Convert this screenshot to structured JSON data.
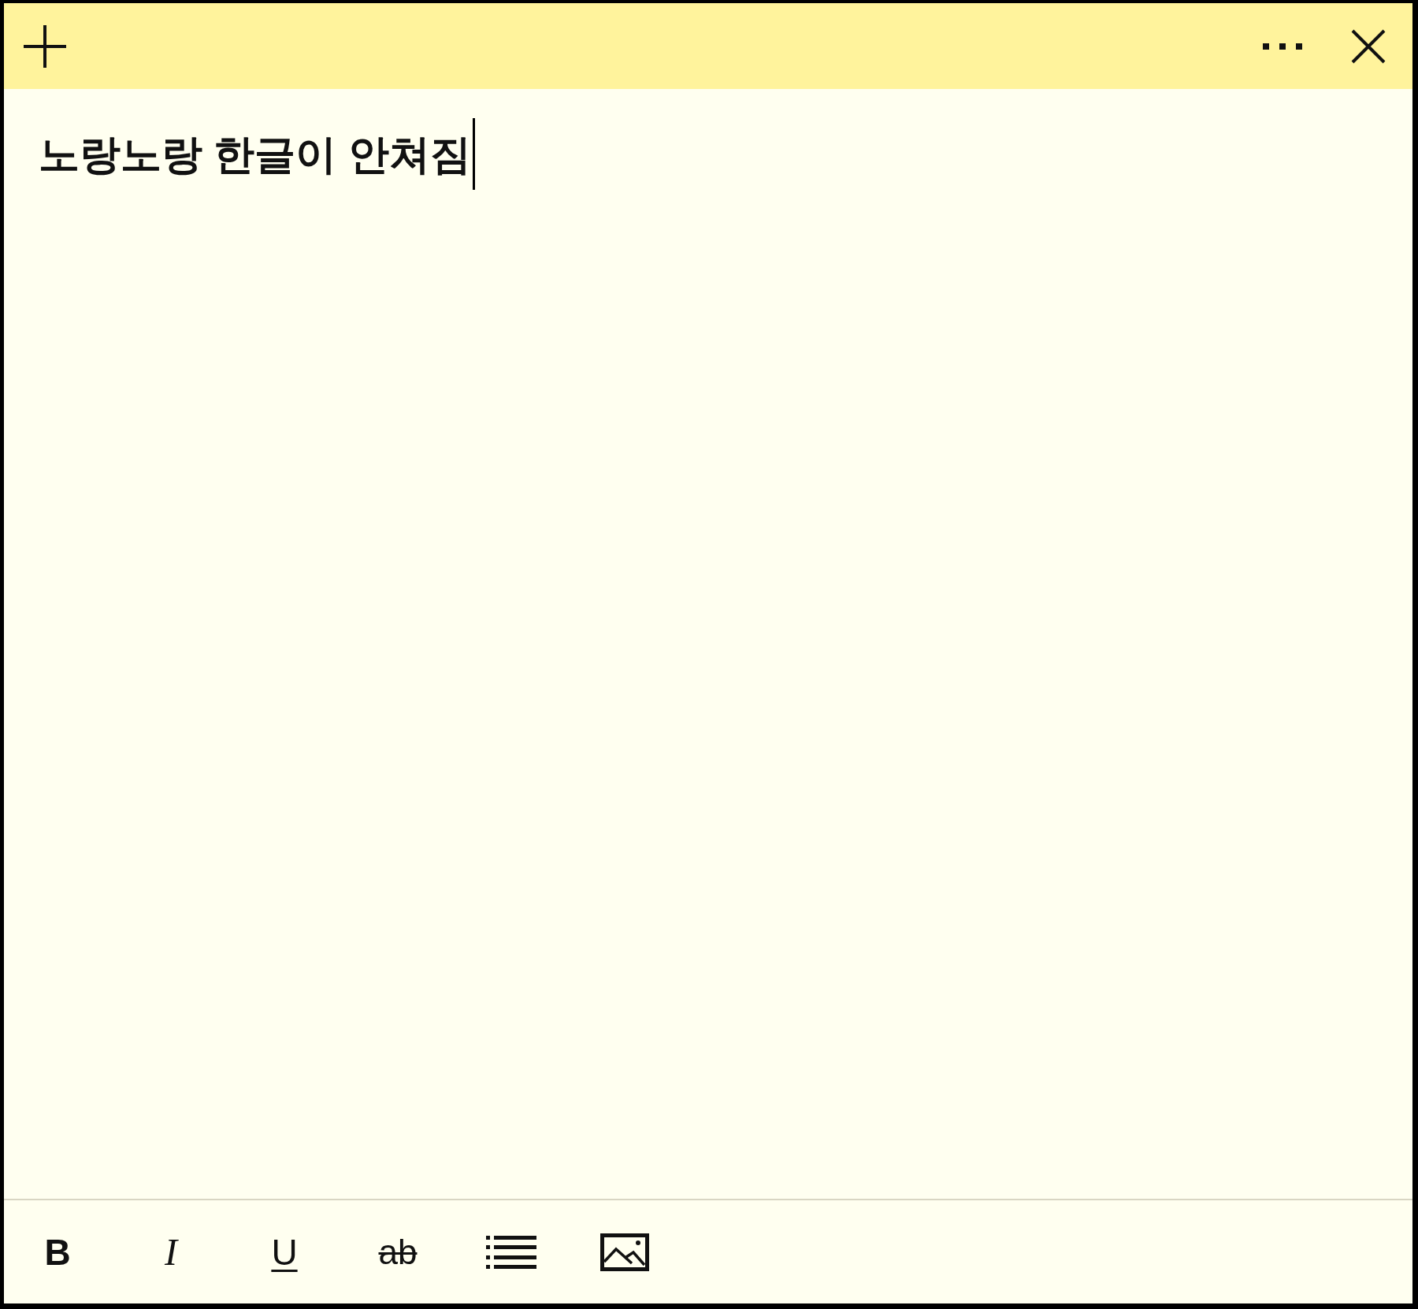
{
  "header": {
    "buttons": [
      {
        "kind": "add"
      },
      {
        "kind": "menu"
      },
      {
        "kind": "close"
      }
    ]
  },
  "note": {
    "text": "노랑노랑 한글이 안쳐짐",
    "caret": true
  },
  "toolbar": {
    "buttons": [
      {
        "kind": "bold",
        "label": "B"
      },
      {
        "kind": "italic",
        "label": "I"
      },
      {
        "kind": "underline",
        "label": "U"
      },
      {
        "kind": "strikethrough",
        "label": "ab"
      },
      {
        "kind": "list"
      },
      {
        "kind": "image"
      }
    ]
  }
}
